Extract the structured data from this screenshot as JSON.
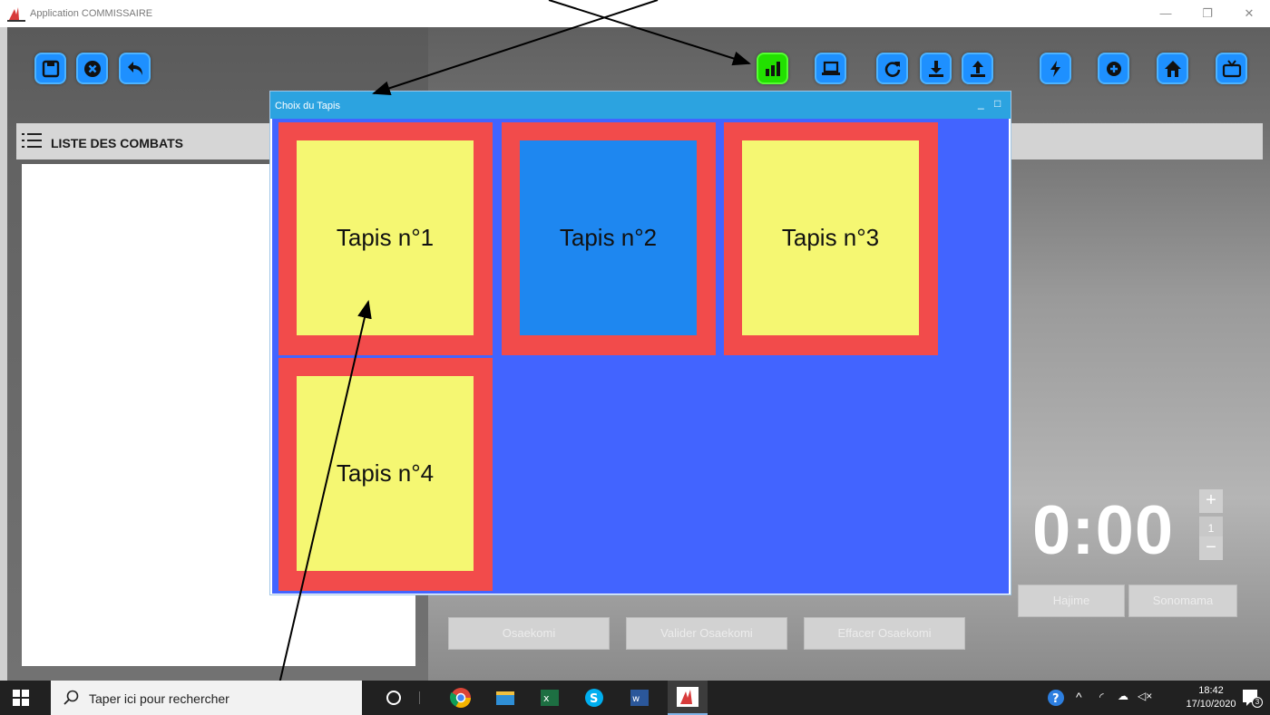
{
  "window": {
    "title": "Application COMMISSAIRE"
  },
  "list_header": {
    "label": "LISTE DES COMBATS"
  },
  "dialog": {
    "title": "Choix du Tapis",
    "mats": [
      {
        "label": "Tapis n°1",
        "state": "available",
        "color": "#f5f772"
      },
      {
        "label": "Tapis n°2",
        "state": "selected",
        "color": "#1e87f0"
      },
      {
        "label": "Tapis n°3",
        "state": "available",
        "color": "#f5f772"
      },
      {
        "label": "Tapis n°4",
        "state": "available",
        "color": "#f5f772"
      }
    ]
  },
  "timer": {
    "value": "0:00",
    "counter": "1"
  },
  "buttons": {
    "hajime": "Hajime",
    "sonomama": "Sonomama",
    "osaekomi": "Osaekomi",
    "valider_osaekomi": "Valider Osaekomi",
    "effacer_osaekomi": "Effacer Osaekomi"
  },
  "toolbar_left": [
    "save-icon",
    "close-circle-icon",
    "undo-icon"
  ],
  "toolbar_right": [
    "bar-chart-icon",
    "laptop-icon",
    "refresh-icon",
    "download-icon",
    "upload-icon",
    "flash-icon",
    "plus-circle-icon",
    "home-icon",
    "tv-icon"
  ],
  "taskbar": {
    "search_placeholder": "Taper ici pour rechercher",
    "time": "18:42",
    "date": "17/10/2020",
    "notifications": "3"
  },
  "colors": {
    "accent": "#1e90ff",
    "active_toolbar": "#22e000",
    "mat_border": "#f24b4b",
    "dialog_bg": "#4264ff",
    "dialog_title": "#2ca3e0"
  }
}
